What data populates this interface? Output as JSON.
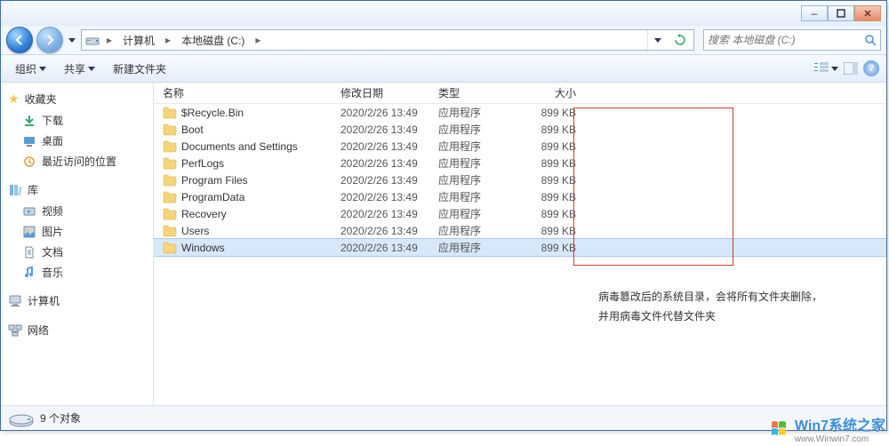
{
  "window": {
    "minimize": "–",
    "maximize": "□",
    "close": "×"
  },
  "breadcrumb": {
    "computer": "计算机",
    "drive": "本地磁盘 (C:)"
  },
  "search": {
    "placeholder": "搜索 本地磁盘 (C:)"
  },
  "toolbar": {
    "organize": "组织",
    "share": "共享",
    "newfolder": "新建文件夹"
  },
  "sidebar": {
    "favorites": "收藏夹",
    "fav_items": [
      "下载",
      "桌面",
      "最近访问的位置"
    ],
    "libraries": "库",
    "lib_items": [
      "视频",
      "图片",
      "文档",
      "音乐"
    ],
    "computer": "计算机",
    "network": "网络"
  },
  "columns": {
    "name": "名称",
    "date": "修改日期",
    "type": "类型",
    "size": "大小"
  },
  "files": [
    {
      "name": "$Recycle.Bin",
      "date": "2020/2/26 13:49",
      "type": "应用程序",
      "size": "899 KB"
    },
    {
      "name": "Boot",
      "date": "2020/2/26 13:49",
      "type": "应用程序",
      "size": "899 KB"
    },
    {
      "name": "Documents and Settings",
      "date": "2020/2/26 13:49",
      "type": "应用程序",
      "size": "899 KB"
    },
    {
      "name": "PerfLogs",
      "date": "2020/2/26 13:49",
      "type": "应用程序",
      "size": "899 KB"
    },
    {
      "name": "Program Files",
      "date": "2020/2/26 13:49",
      "type": "应用程序",
      "size": "899 KB"
    },
    {
      "name": "ProgramData",
      "date": "2020/2/26 13:49",
      "type": "应用程序",
      "size": "899 KB"
    },
    {
      "name": "Recovery",
      "date": "2020/2/26 13:49",
      "type": "应用程序",
      "size": "899 KB"
    },
    {
      "name": "Users",
      "date": "2020/2/26 13:49",
      "type": "应用程序",
      "size": "899 KB"
    },
    {
      "name": "Windows",
      "date": "2020/2/26 13:49",
      "type": "应用程序",
      "size": "899 KB",
      "selected": true
    }
  ],
  "annotation": {
    "line1": "病毒篡改后的系统目录，会将所有文件夹删除，",
    "line2": "并用病毒文件代替文件夹"
  },
  "status": {
    "count": "9 个对象"
  },
  "watermark": {
    "title": "Win7系统之家",
    "sub": "www.Winwin7.com"
  }
}
